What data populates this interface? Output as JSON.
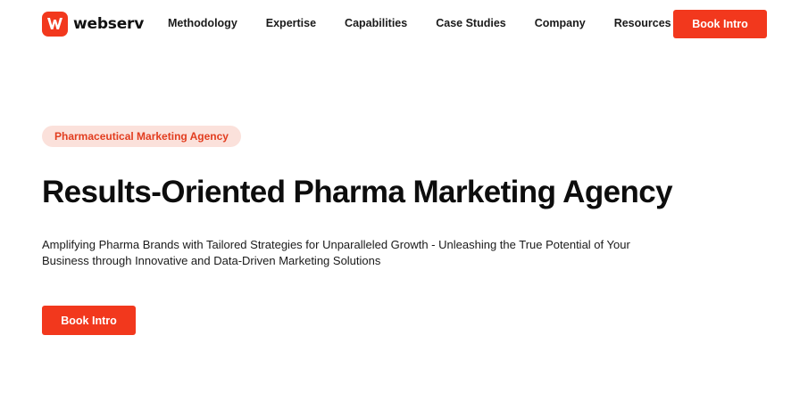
{
  "brand": {
    "name": "webserv",
    "accent_color": "#f2381d",
    "badge_bg": "#fbe1db"
  },
  "nav": {
    "items": [
      {
        "label": "Methodology"
      },
      {
        "label": "Expertise"
      },
      {
        "label": "Capabilities"
      },
      {
        "label": "Case Studies"
      },
      {
        "label": "Company"
      },
      {
        "label": "Resources"
      }
    ],
    "cta_label": "Book Intro"
  },
  "hero": {
    "badge": "Pharmaceutical Marketing Agency",
    "title": "Results-Oriented Pharma Marketing Agency",
    "subtitle_line1": "Amplifying Pharma Brands with Tailored Strategies for Unparalleled Growth - Unleashing the True Potential of Your",
    "subtitle_line2": "Business through Innovative and Data-Driven Marketing Solutions",
    "cta_label": "Book Intro"
  }
}
